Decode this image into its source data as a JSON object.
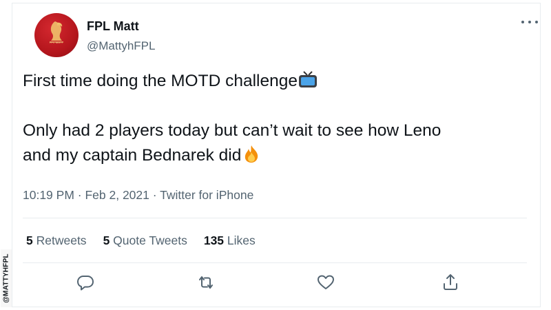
{
  "author": {
    "name": "FPL Matt",
    "handle": "@MattyhFPL",
    "avatar_text": "FPL MATT",
    "avatar_color": "#c41e24"
  },
  "tweet": {
    "line1": "First time doing the MOTD challenge",
    "line1_emoji": "tv-icon",
    "line2": "Only had 2 players today but can’t wait to see how Leno",
    "line3": "and my captain Bednarek did",
    "line3_emoji": "fire-icon"
  },
  "meta": {
    "time": "10:19 PM",
    "sep1": " · ",
    "date": "Feb 2, 2021",
    "sep2": " · ",
    "source": "Twitter for iPhone"
  },
  "stats": {
    "retweets_count": "5",
    "retweets_label": "Retweets",
    "quote_count": "5",
    "quote_label": "Quote Tweets",
    "likes_count": "135",
    "likes_label": "Likes"
  },
  "actions": [
    "reply-icon",
    "retweet-icon",
    "like-icon",
    "share-icon"
  ],
  "watermark": "@MATTYHFPL",
  "colors": {
    "text": "#0f1419",
    "secondary": "#536471",
    "border": "#e8ecef"
  }
}
